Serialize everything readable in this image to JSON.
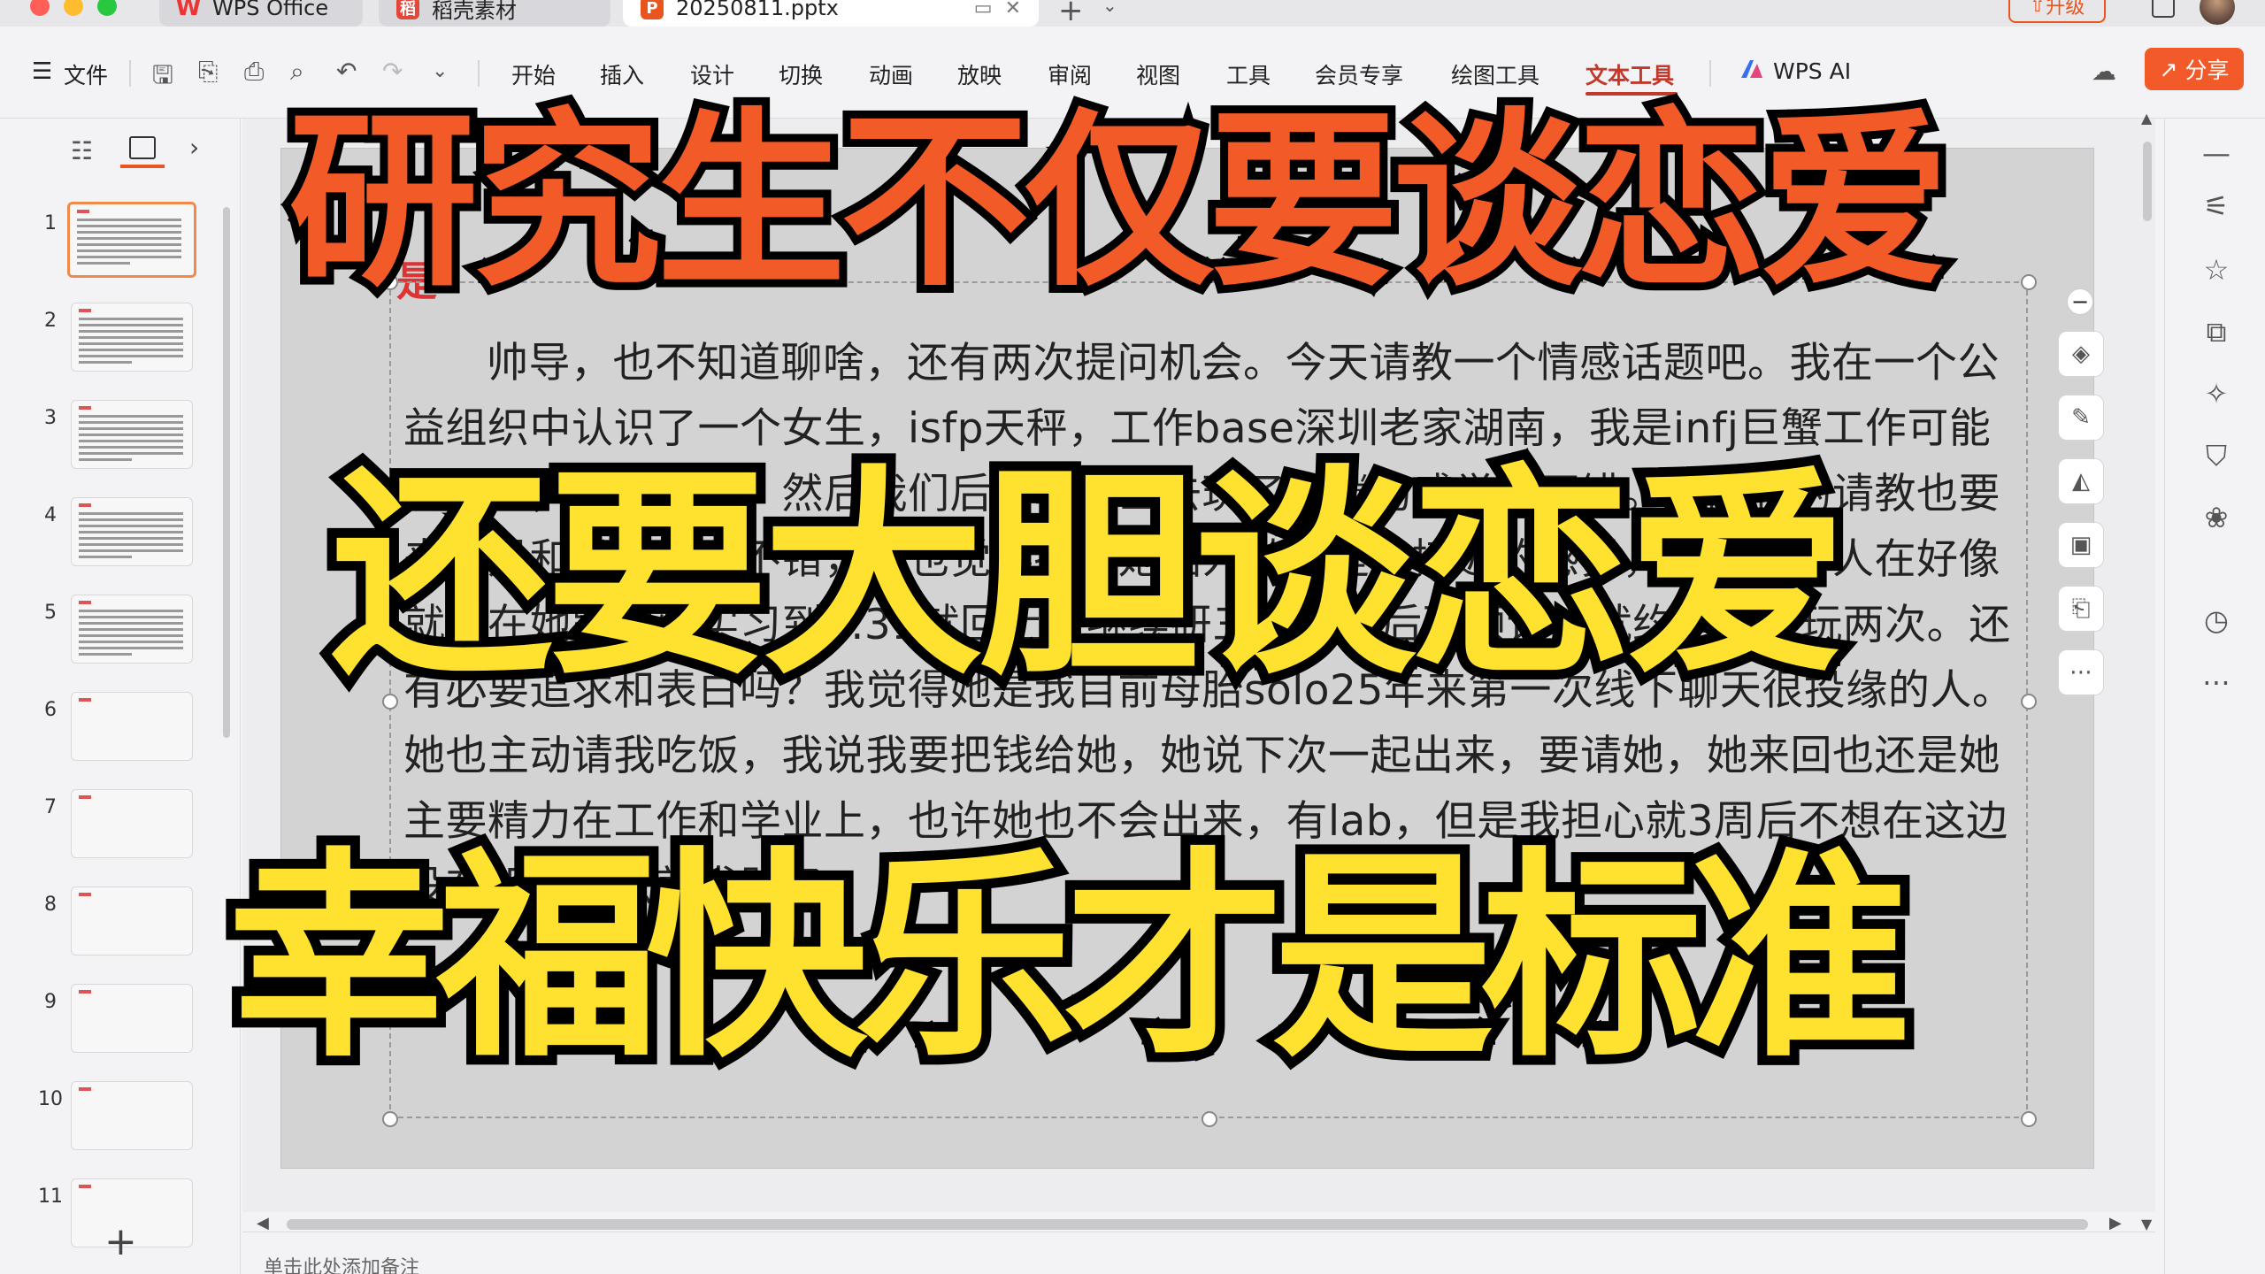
{
  "tabs": {
    "wps_label": "WPS Office",
    "daoke_label": "稻壳素材",
    "file_label": "20250811.pptx",
    "upgrade_label": "升级"
  },
  "menubar": {
    "file_label": "文件",
    "items": [
      "开始",
      "插入",
      "设计",
      "切换",
      "动画",
      "放映",
      "审阅",
      "视图",
      "工具",
      "会员专享",
      "绘图工具",
      "文本工具"
    ],
    "wps_ai_label": "WPS AI",
    "share_label": "分享",
    "accent_color": "#c0392b",
    "share_color": "#f35a2a"
  },
  "slide_panel": {
    "numbers": [
      "1",
      "2",
      "3",
      "4",
      "5",
      "6",
      "7",
      "8",
      "9",
      "10",
      "11"
    ],
    "active_index": 0
  },
  "slide": {
    "title_fragment": "是",
    "body_text": "帅导，也不知道聊啥，还有两次提问机会。今天请教一个情感话题吧。我在一个公益组织中认识了一个女生，isfp天秤，工作base深圳老家湖南，我是infj巨蟹工作可能会上海，是江苏人，然后我们后面单独出去玩了一趟的感觉很不错。她问我的请教也要来也是和我感觉也不错，我也觉得接近她因为她会是我接近的感觉，但她是有人在好像就是在她跟向州实习到8.31就回上海继续研三了。我后面预计也就约她出来玩两次。还有必要追求和表白吗？我觉得她是我目前母胎solo25年来第一次线下聊天很投缘的人。她也主动请我吃饭，我说我要把钱给她，她说下次一起出来，要请她，她来回也还是她主要精力在工作和学业上，也许她也不会出来，有lab，但是我担心就3周后不想在这边没有机会来去就求助了"
  },
  "notes": {
    "placeholder": "单击此处添加备注"
  },
  "overlay": {
    "line1": "研究生不仅要谈恋爱",
    "line2": "还要大胆谈恋爱",
    "line3": "幸福快乐才是标准",
    "line1_color": "#f25a28",
    "line2_color": "#ffe22f",
    "line3_color": "#ffe22f"
  }
}
